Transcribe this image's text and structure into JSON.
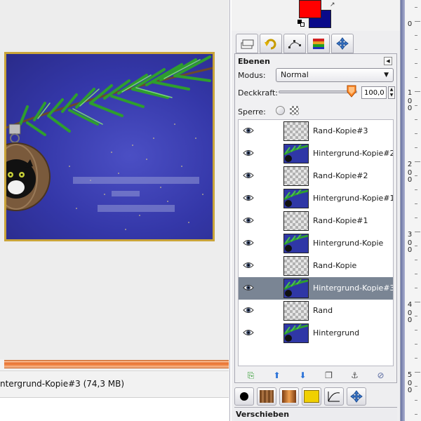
{
  "status": {
    "text": "ntergrund-Kopie#3 (74,3 MB)"
  },
  "colors": {
    "foreground": "#ff0000",
    "background": "#0a0a8a"
  },
  "layers_panel": {
    "title": "Ebenen",
    "mode_label": "Modus:",
    "mode_value": "Normal",
    "opacity_label": "Deckkraft:",
    "opacity_value": "100,0",
    "lock_label": "Sperre:",
    "layers": [
      {
        "name": "Rand-Kopie#3",
        "thumb": "alpha",
        "visible": true,
        "selected": false
      },
      {
        "name": "Hintergrund-Kopie#2",
        "thumb": "image",
        "visible": true,
        "selected": false
      },
      {
        "name": "Rand-Kopie#2",
        "thumb": "alpha",
        "visible": true,
        "selected": false
      },
      {
        "name": "Hintergrund-Kopie#1",
        "thumb": "image",
        "visible": true,
        "selected": false
      },
      {
        "name": "Rand-Kopie#1",
        "thumb": "alpha",
        "visible": true,
        "selected": false
      },
      {
        "name": "Hintergrund-Kopie",
        "thumb": "image",
        "visible": true,
        "selected": false
      },
      {
        "name": "Rand-Kopie",
        "thumb": "alpha",
        "visible": true,
        "selected": false
      },
      {
        "name": "Hintergrund-Kopie#3",
        "thumb": "image",
        "visible": true,
        "selected": true
      },
      {
        "name": "Rand",
        "thumb": "alpha",
        "visible": true,
        "selected": false
      },
      {
        "name": "Hintergrund",
        "thumb": "image",
        "visible": true,
        "selected": false
      }
    ],
    "buttons": [
      "new-layer-icon",
      "raise-layer-icon",
      "lower-layer-icon",
      "duplicate-layer-icon",
      "anchor-layer-icon",
      "delete-layer-icon"
    ]
  },
  "dock_tabs": [
    "layers-tab-icon",
    "undo-history-tab-icon",
    "paths-tab-icon",
    "palettes-tab-icon",
    "move-tab-icon"
  ],
  "tool_options": {
    "title": "Verschieben"
  },
  "ruler": {
    "labels": [
      "0",
      "1",
      "0",
      "0",
      "2",
      "0",
      "0",
      "3",
      "0",
      "0",
      "4",
      "0",
      "0",
      "5",
      "0",
      "0"
    ]
  }
}
